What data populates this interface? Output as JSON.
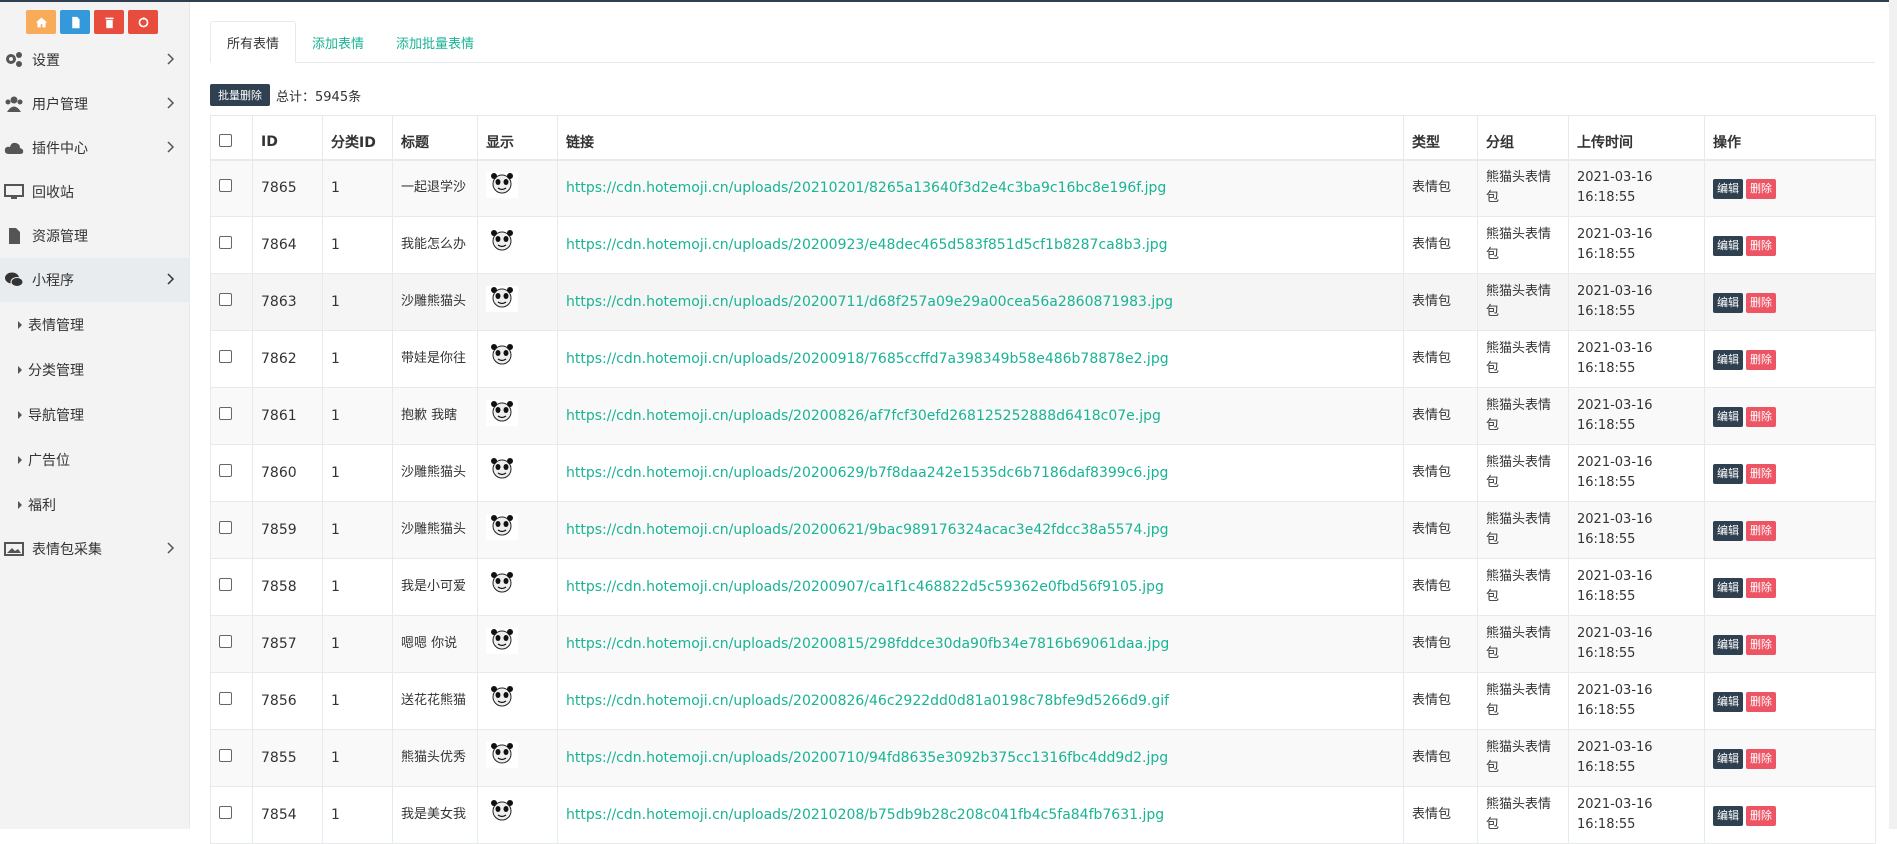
{
  "quick_buttons": [
    {
      "icon": "home-icon",
      "color": "#f8ac59"
    },
    {
      "icon": "document-icon",
      "color": "#3498db"
    },
    {
      "icon": "trash-icon",
      "color": "#e74c3c"
    },
    {
      "icon": "recycle-icon",
      "color": "#e74c3c"
    }
  ],
  "sidebar": {
    "items": [
      {
        "label": "设置",
        "icon": "gears-icon"
      },
      {
        "label": "用户管理",
        "icon": "users-icon"
      },
      {
        "label": "插件中心",
        "icon": "cloud-icon"
      },
      {
        "label": "回收站",
        "icon": "monitor-icon"
      },
      {
        "label": "资源管理",
        "icon": "file-icon"
      },
      {
        "label": "小程序",
        "icon": "wechat-icon"
      },
      {
        "label": "表情包采集",
        "icon": "image-icon"
      }
    ],
    "subitems": [
      "表情管理",
      "分类管理",
      "导航管理",
      "广告位",
      "福利"
    ]
  },
  "tabs": [
    "所有表情",
    "添加表情",
    "添加批量表情"
  ],
  "toolbar": {
    "bulk_delete": "批量删除",
    "total": "总计：5945条"
  },
  "table": {
    "headers": [
      "ID",
      "分类ID",
      "标题",
      "显示",
      "链接",
      "类型",
      "分组",
      "上传时间",
      "操作"
    ],
    "edit_label": "编辑",
    "delete_label": "删除",
    "rows": [
      {
        "id": "7865",
        "cat": "1",
        "title": "一起退学沙",
        "url": "https://cdn.hotemoji.cn/uploads/20210201/8265a13640f3d2e4c3ba9c16bc8e196f.jpg",
        "type": "表情包",
        "group": "熊猫头表情包",
        "date": "2021-03-16",
        "time": "16:18:55"
      },
      {
        "id": "7864",
        "cat": "1",
        "title": "我能怎么办",
        "url": "https://cdn.hotemoji.cn/uploads/20200923/e48dec465d583f851d5cf1b8287ca8b3.jpg",
        "type": "表情包",
        "group": "熊猫头表情包",
        "date": "2021-03-16",
        "time": "16:18:55"
      },
      {
        "id": "7863",
        "cat": "1",
        "title": "沙雕熊猫头",
        "url": "https://cdn.hotemoji.cn/uploads/20200711/d68f257a09e29a00cea56a2860871983.jpg",
        "type": "表情包",
        "group": "熊猫头表情包",
        "date": "2021-03-16",
        "time": "16:18:55"
      },
      {
        "id": "7862",
        "cat": "1",
        "title": "带娃是你往",
        "url": "https://cdn.hotemoji.cn/uploads/20200918/7685ccffd7a398349b58e486b78878e2.jpg",
        "type": "表情包",
        "group": "熊猫头表情包",
        "date": "2021-03-16",
        "time": "16:18:55"
      },
      {
        "id": "7861",
        "cat": "1",
        "title": "抱歉 我瞎",
        "url": "https://cdn.hotemoji.cn/uploads/20200826/af7fcf30efd268125252888d6418c07e.jpg",
        "type": "表情包",
        "group": "熊猫头表情包",
        "date": "2021-03-16",
        "time": "16:18:55"
      },
      {
        "id": "7860",
        "cat": "1",
        "title": "沙雕熊猫头",
        "url": "https://cdn.hotemoji.cn/uploads/20200629/b7f8daa242e1535dc6b7186daf8399c6.jpg",
        "type": "表情包",
        "group": "熊猫头表情包",
        "date": "2021-03-16",
        "time": "16:18:55"
      },
      {
        "id": "7859",
        "cat": "1",
        "title": "沙雕熊猫头",
        "url": "https://cdn.hotemoji.cn/uploads/20200621/9bac989176324acac3e42fdcc38a5574.jpg",
        "type": "表情包",
        "group": "熊猫头表情包",
        "date": "2021-03-16",
        "time": "16:18:55"
      },
      {
        "id": "7858",
        "cat": "1",
        "title": "我是小可爱",
        "url": "https://cdn.hotemoji.cn/uploads/20200907/ca1f1c468822d5c59362e0fbd56f9105.jpg",
        "type": "表情包",
        "group": "熊猫头表情包",
        "date": "2021-03-16",
        "time": "16:18:55"
      },
      {
        "id": "7857",
        "cat": "1",
        "title": "嗯嗯 你说",
        "url": "https://cdn.hotemoji.cn/uploads/20200815/298fddce30da90fb34e7816b69061daa.jpg",
        "type": "表情包",
        "group": "熊猫头表情包",
        "date": "2021-03-16",
        "time": "16:18:55"
      },
      {
        "id": "7856",
        "cat": "1",
        "title": "送花花熊猫",
        "url": "https://cdn.hotemoji.cn/uploads/20200826/46c2922dd0d81a0198c78bfe9d5266d9.gif",
        "type": "表情包",
        "group": "熊猫头表情包",
        "date": "2021-03-16",
        "time": "16:18:55"
      },
      {
        "id": "7855",
        "cat": "1",
        "title": "熊猫头优秀",
        "url": "https://cdn.hotemoji.cn/uploads/20200710/94fd8635e3092b375cc1316fbc4dd9d2.jpg",
        "type": "表情包",
        "group": "熊猫头表情包",
        "date": "2021-03-16",
        "time": "16:18:55"
      },
      {
        "id": "7854",
        "cat": "1",
        "title": "我是美女我",
        "url": "https://cdn.hotemoji.cn/uploads/20210208/b75db9b28c208c041fb4c5fa84fb7631.jpg",
        "type": "表情包",
        "group": "熊猫头表情包",
        "date": "2021-03-16",
        "time": "16:18:55"
      }
    ]
  }
}
